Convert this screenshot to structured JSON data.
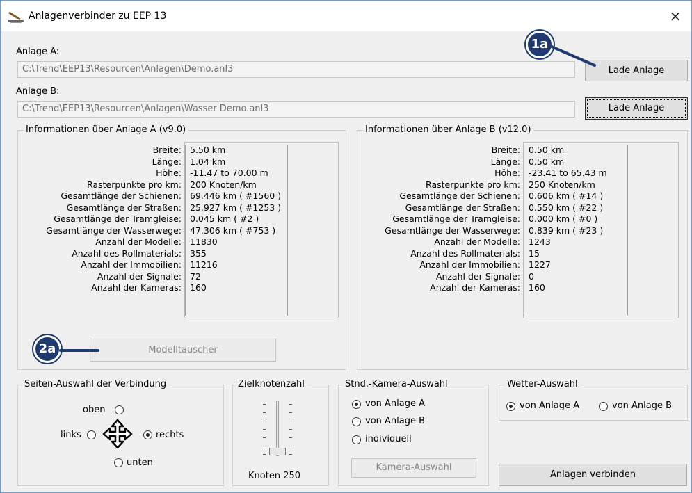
{
  "window": {
    "title": "Anlagenverbinder zu EEP 13",
    "close": "×"
  },
  "anlage_a": {
    "label": "Anlage A:",
    "path": "C:\\Trend\\EEP13\\Resourcen\\Anlagen\\Demo.anl3",
    "button": "Lade Anlage"
  },
  "anlage_b": {
    "label": "Anlage B:",
    "path": "C:\\Trend\\EEP13\\Resourcen\\Anlagen\\Wasser Demo.anl3",
    "button": "Lade Anlage"
  },
  "info_labels": [
    "Breite:",
    "Länge:",
    "Höhe:",
    "Rasterpunkte pro km:",
    "Gesamtlänge der Schienen:",
    "Gesamtlänge der Straßen:",
    "Gesamtlänge der Tramgleise:",
    "Gesamtlänge der Wasserwege:",
    "Anzahl der Modelle:",
    "Anzahl des Rollmaterials:",
    "Anzahl der Immobilien:",
    "Anzahl der Signale:",
    "Anzahl der Kameras:"
  ],
  "info_a": {
    "title": "Informationen über Anlage A (v9.0)",
    "values": [
      "5.50 km",
      "1.04 km",
      "-11.47 to 70.00 m",
      "200 Knoten/km",
      "69.446 km ( #1560 )",
      "25.927 km ( #1253 )",
      "0.045 km ( #2 )",
      "47.306 km ( #753 )",
      "11830",
      "355",
      "11216",
      "72",
      "160"
    ]
  },
  "info_b": {
    "title": "Informationen über Anlage B (v12.0)",
    "values": [
      "0.50 km",
      "0.50 km",
      "-23.41 to 65.43 m",
      "250 Knoten/km",
      "0.606 km ( #14 )",
      "0.550 km ( #22 )",
      "0.000 km ( #0 )",
      "0.839 km ( #23 )",
      "1243",
      "15",
      "1227",
      "0",
      "160"
    ]
  },
  "modelltauscher_button": "Modelltauscher",
  "badges": {
    "b1": "1a",
    "b2": "2a"
  },
  "seiten": {
    "title": "Seiten-Auswahl der Verbindung",
    "oben": "oben",
    "links": "links",
    "rechts": "rechts",
    "unten": "unten",
    "selected": "rechts"
  },
  "ziel": {
    "title": "Zielknotenzahl",
    "value_label": "Knoten 250"
  },
  "kamera": {
    "title": "Stnd.-Kamera-Auswahl",
    "opt1": "von Anlage A",
    "opt2": "von Anlage B",
    "opt3": "individuell",
    "button": "Kamera-Auswahl",
    "selected": "von Anlage A"
  },
  "wetter": {
    "title": "Wetter-Auswahl",
    "opt1": "von Anlage A",
    "opt2": "von Anlage B",
    "selected": "von Anlage A"
  },
  "verbinden_button": "Anlagen verbinden",
  "colors": {
    "badge": "#1f3a6e",
    "window_bg": "#f0f0f0"
  }
}
